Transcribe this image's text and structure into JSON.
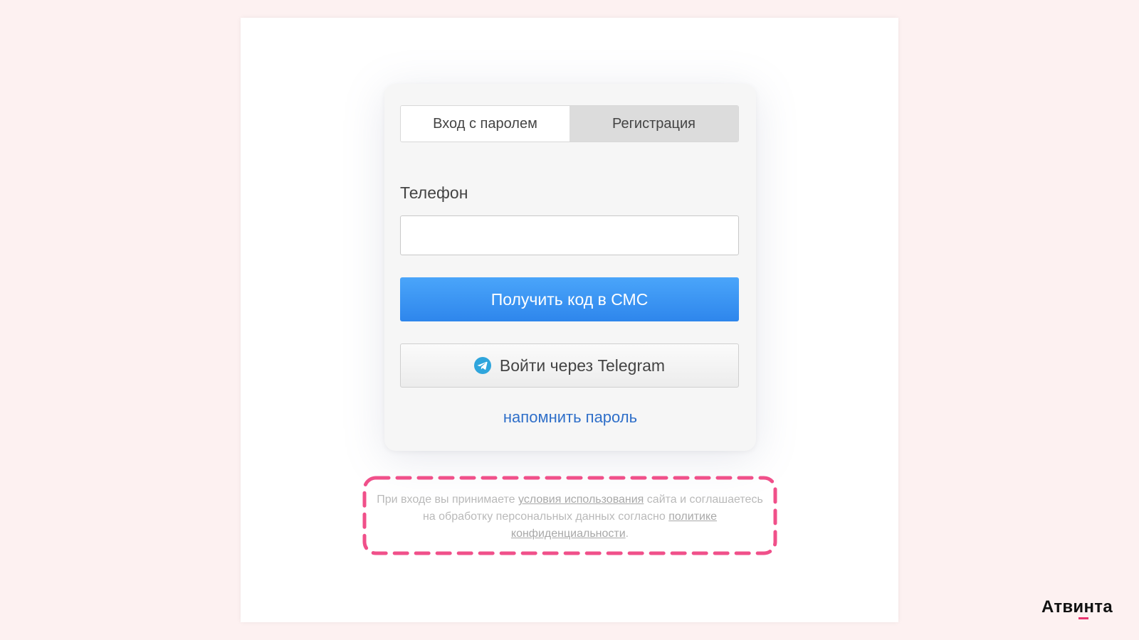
{
  "tabs": [
    {
      "label": "Вход с паролем",
      "active": true
    },
    {
      "label": "Регистрация",
      "active": false
    }
  ],
  "form": {
    "phone_label": "Телефон",
    "phone_value": "",
    "sms_button": "Получить код в СМС",
    "telegram_button": "Войти через Telegram",
    "remind_link": "напомнить пароль"
  },
  "legal": {
    "part1": "При входе вы принимаете ",
    "terms_link": "условия использования",
    "part2": " сайта и соглашаетесь на обработку персональных данных согласно ",
    "privacy_link": "политике конфиденциальности",
    "part3": "."
  },
  "brand": {
    "name": "Атвинта"
  },
  "colors": {
    "accent": "#2e86ec",
    "highlight": "#f0508a",
    "link": "#2f6fc9"
  },
  "icons": {
    "telegram": "telegram-icon"
  }
}
